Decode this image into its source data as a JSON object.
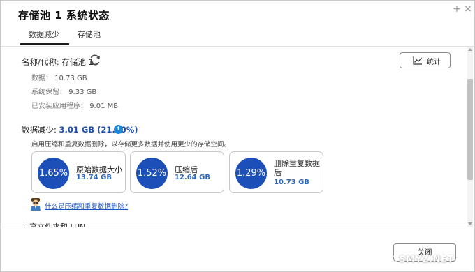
{
  "window": {
    "title": "存储池 1 系统状态",
    "add_glyph": "+",
    "close_glyph": "×"
  },
  "tabs": [
    {
      "label": "数据减少",
      "active": true
    },
    {
      "label": "存储池",
      "active": false
    }
  ],
  "pool": {
    "name_line": "名称/代称: 存储池 1",
    "stats_button_label": "统计",
    "details": [
      {
        "label": "数据：",
        "value": "10.73 GB"
      },
      {
        "label": "系统保留：",
        "value": "9.33 GB"
      },
      {
        "label": "已安装应用程序：",
        "value": "9.01 MB"
      }
    ]
  },
  "reduction": {
    "label": "数据减少:",
    "value": "3.01 GB (21.90%)",
    "description": "启用压缩和重复数据删除，以存储更多数据并使用更少的存储空间。",
    "cards": [
      {
        "percent": "1.65%",
        "label": "原始数据大小",
        "size": "13.74 GB"
      },
      {
        "percent": "1.52%",
        "label": "压缩后",
        "size": "12.64 GB"
      },
      {
        "percent": "1.29%",
        "label": "删除重复数据后",
        "size": "10.73 GB"
      }
    ],
    "help_link": "什么是压缩和重复数据删除?"
  },
  "next_section": "共享文件夹和 LUN",
  "footer": {
    "close_label": "关闭"
  },
  "watermark": "SMYZ.NET",
  "colors": {
    "accent_blue": "#1d4fb8",
    "link_blue": "#1d54c2",
    "info_blue": "#1f87d8"
  },
  "icons": {
    "refresh": "refresh-icon",
    "info": "info-icon",
    "chart": "line-chart-icon",
    "help": "help-avatar-icon"
  }
}
